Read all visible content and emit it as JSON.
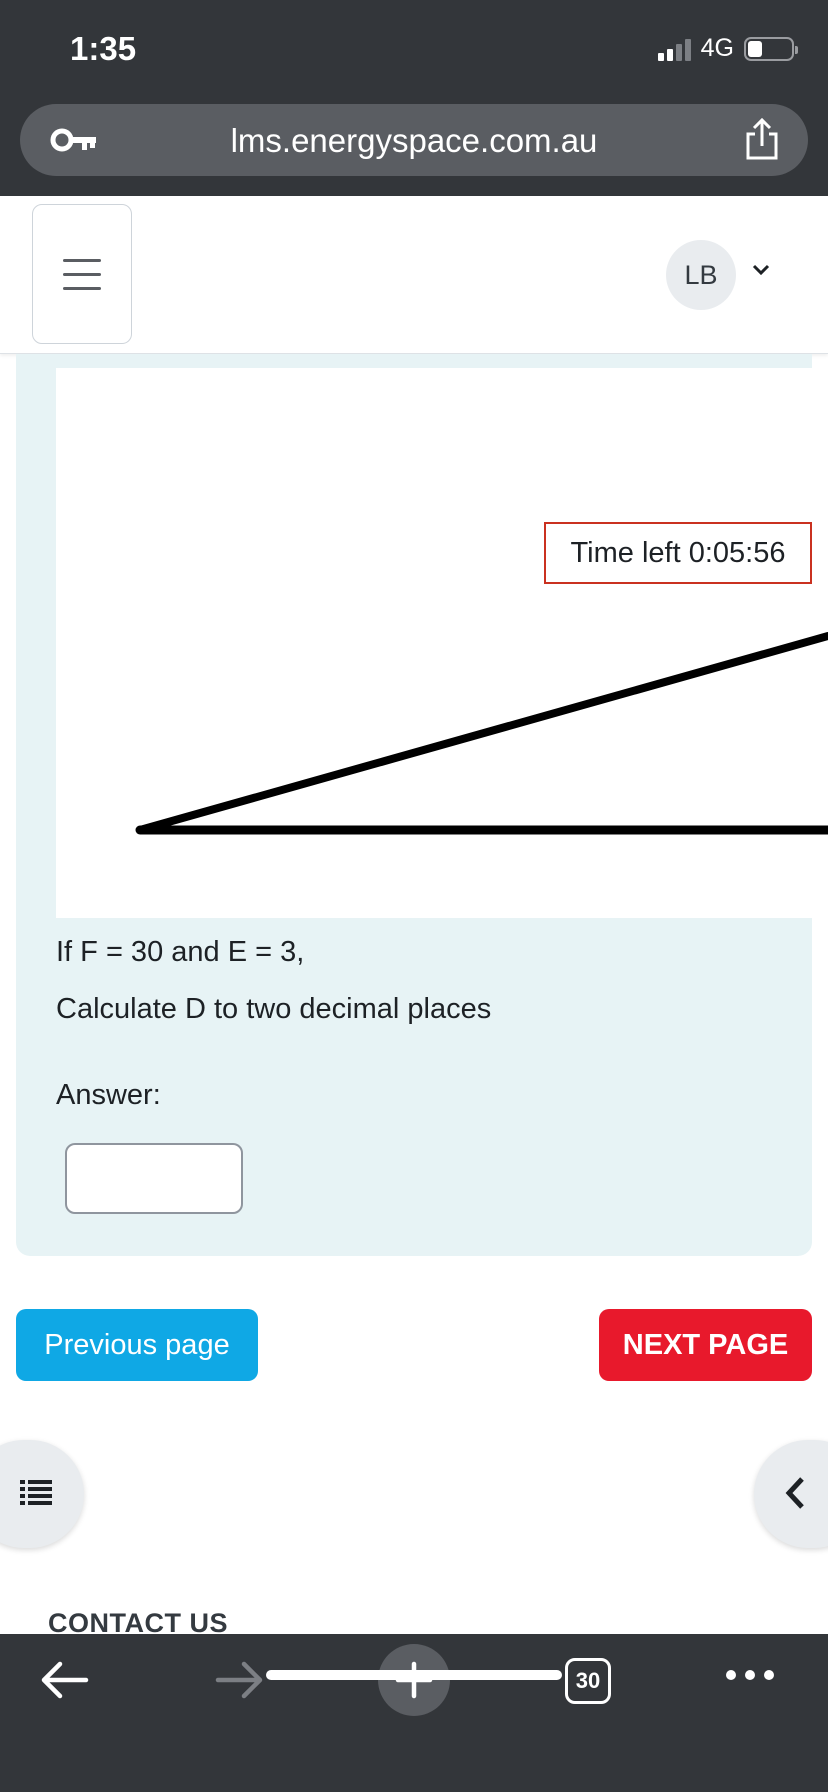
{
  "status_bar": {
    "time": "1:35",
    "network": "4G",
    "battery_level": 0.3
  },
  "browser": {
    "url": "lms.energyspace.com.au",
    "tab_count": "30",
    "icons": [
      "key-icon",
      "share-icon",
      "back-arrow-icon",
      "forward-arrow-icon",
      "plus-icon",
      "tabs-icon",
      "more-icon"
    ]
  },
  "header": {
    "user_initials": "LB"
  },
  "quiz": {
    "timer_text": "Time left 0:05:56",
    "question_line_1": "If F = 30 and E = 3,",
    "question_line_2": "Calculate D to two decimal places",
    "answer_label": "Answer:",
    "answer_value": ""
  },
  "navigation": {
    "previous_label": "Previous page",
    "next_label": "NEXT PAGE"
  },
  "footer": {
    "contact_heading": "CONTACT US"
  },
  "colors": {
    "previous_button": "#0fa8e5",
    "next_button": "#e8192c",
    "panel_background": "#e7f3f5",
    "timer_border": "#ca3120",
    "browser_chrome": "#33363a"
  }
}
